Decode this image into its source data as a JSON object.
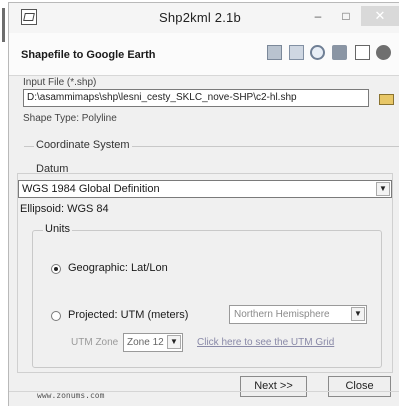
{
  "window": {
    "title": "Shp2kml 2.1b",
    "minimize_glyph": "–",
    "maximize_glyph": "□",
    "close_glyph": "✕"
  },
  "header": {
    "subtitle": "Shapefile to Google Earth",
    "toolbar_icons": [
      "table-icon",
      "grid-icon",
      "zoom-icon",
      "tool-icon",
      "chart-icon",
      "help-icon"
    ]
  },
  "input": {
    "label": "Input File (*.shp)",
    "path": "D:\\asammimaps\\shp\\lesni_cesty_SKLC_nove-SHP\\c2-hl.shp",
    "shape_type": "Shape Type: Polyline"
  },
  "coordinate_system": {
    "legend": "Coordinate System",
    "datum_label": "Datum",
    "selected": "WGS 1984 Global Definition",
    "ellipsoid": "Ellipsoid: WGS 84"
  },
  "units": {
    "legend": "Units",
    "geographic_label": "Geographic: Lat/Lon",
    "projected_label": "Projected: UTM (meters)",
    "hemisphere": "Northern Hemisphere",
    "zone_label": "UTM Zone",
    "zone_value": "Zone 12",
    "utm_link": "Click here to see the UTM Grid"
  },
  "footer": {
    "site": "www.zonums.com",
    "next": "Next >>",
    "close": "Close"
  }
}
